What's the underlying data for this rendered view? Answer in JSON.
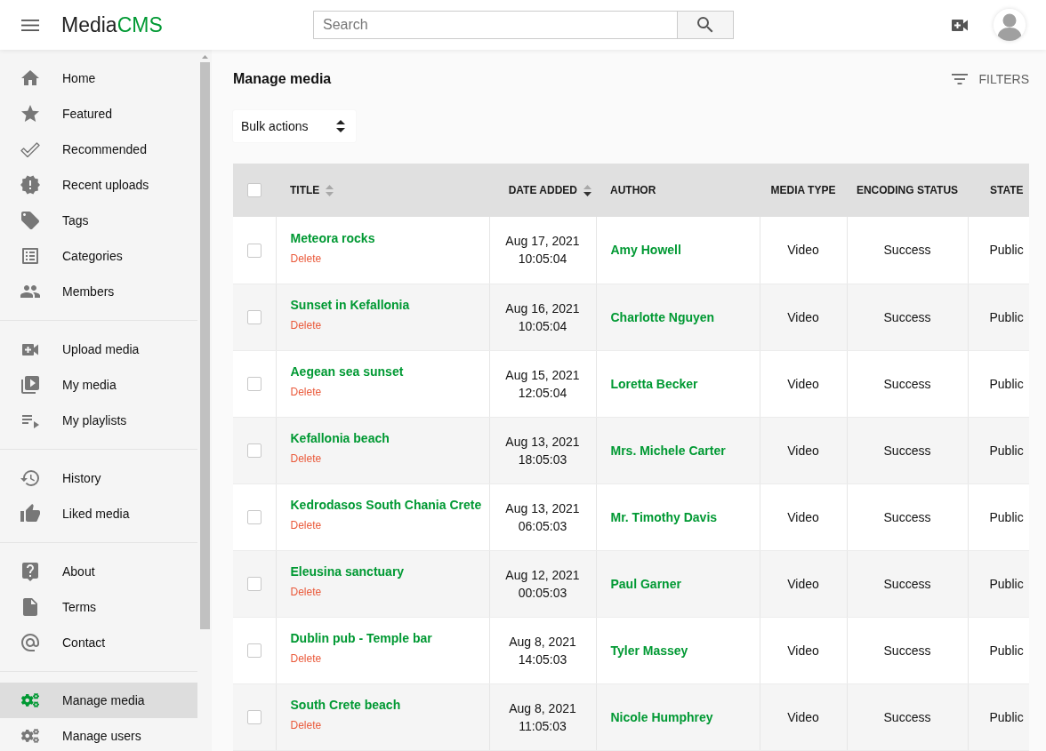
{
  "header": {
    "logo": {
      "text": "Media",
      "accent": "CMS"
    },
    "search": {
      "placeholder": "Search"
    }
  },
  "sidebar": {
    "sections": [
      {
        "items": [
          {
            "label": "Home",
            "selected": false
          },
          {
            "label": "Featured",
            "selected": false
          },
          {
            "label": "Recommended",
            "selected": false
          },
          {
            "label": "Recent uploads",
            "selected": false
          },
          {
            "label": "Tags",
            "selected": false
          },
          {
            "label": "Categories",
            "selected": false
          },
          {
            "label": "Members",
            "selected": false
          }
        ]
      },
      {
        "items": [
          {
            "label": "Upload media",
            "selected": false
          },
          {
            "label": "My media",
            "selected": false
          },
          {
            "label": "My playlists",
            "selected": false
          }
        ]
      },
      {
        "items": [
          {
            "label": "History",
            "selected": false
          },
          {
            "label": "Liked media",
            "selected": false
          }
        ]
      },
      {
        "items": [
          {
            "label": "About",
            "selected": false
          },
          {
            "label": "Terms",
            "selected": false
          },
          {
            "label": "Contact",
            "selected": false
          }
        ]
      },
      {
        "items": [
          {
            "label": "Manage media",
            "selected": true
          },
          {
            "label": "Manage users",
            "selected": false
          }
        ]
      }
    ]
  },
  "page": {
    "title": "Manage media",
    "filters_button": "FILTERS",
    "bulk_actions": "Bulk actions"
  },
  "table": {
    "header_checkbox": {
      "checked": false
    },
    "columns": [
      {
        "label": "TITLE",
        "sortable": true,
        "sorted_ascending": false,
        "sorted_descending": false
      },
      {
        "label": "DATE ADDED",
        "sortable": true,
        "sorted_ascending": false,
        "sorted_descending": true
      },
      {
        "label": "AUTHOR",
        "sortable": false
      },
      {
        "label": "MEDIA TYPE",
        "sortable": false
      },
      {
        "label": "ENCODING STATUS",
        "sortable": false
      },
      {
        "label": "STATE",
        "sortable": false
      }
    ],
    "rows": [
      {
        "checked": false,
        "title": "Meteora rocks",
        "action": "Delete",
        "date": "Aug 17, 2021",
        "time": "10:05:04",
        "author": "Amy Howell",
        "media_type": "Video",
        "encoding_status": "Success",
        "state": "Public"
      },
      {
        "checked": false,
        "title": "Sunset in Kefallonia",
        "action": "Delete",
        "date": "Aug 16, 2021",
        "time": "10:05:04",
        "author": "Charlotte Nguyen",
        "media_type": "Video",
        "encoding_status": "Success",
        "state": "Public"
      },
      {
        "checked": false,
        "title": "Aegean sea sunset",
        "action": "Delete",
        "date": "Aug 15, 2021",
        "time": "12:05:04",
        "author": "Loretta Becker",
        "media_type": "Video",
        "encoding_status": "Success",
        "state": "Public"
      },
      {
        "checked": false,
        "title": "Kefallonia beach",
        "action": "Delete",
        "date": "Aug 13, 2021",
        "time": "18:05:03",
        "author": "Mrs. Michele Carter",
        "media_type": "Video",
        "encoding_status": "Success",
        "state": "Public"
      },
      {
        "checked": false,
        "title": "Kedrodasos South Chania Crete",
        "action": "Delete",
        "date": "Aug 13, 2021",
        "time": "06:05:03",
        "author": "Mr. Timothy Davis",
        "media_type": "Video",
        "encoding_status": "Success",
        "state": "Public"
      },
      {
        "checked": false,
        "title": "Eleusina sanctuary",
        "action": "Delete",
        "date": "Aug 12, 2021",
        "time": "00:05:03",
        "author": "Paul Garner",
        "media_type": "Video",
        "encoding_status": "Success",
        "state": "Public"
      },
      {
        "checked": false,
        "title": "Dublin pub - Temple bar",
        "action": "Delete",
        "date": "Aug 8, 2021",
        "time": "14:05:03",
        "author": "Tyler Massey",
        "media_type": "Video",
        "encoding_status": "Success",
        "state": "Public"
      },
      {
        "checked": false,
        "title": "South Crete beach",
        "action": "Delete",
        "date": "Aug 8, 2021",
        "time": "11:05:03",
        "author": "Nicole Humphrey",
        "media_type": "Video",
        "encoding_status": "Success",
        "state": "Public"
      }
    ]
  }
}
